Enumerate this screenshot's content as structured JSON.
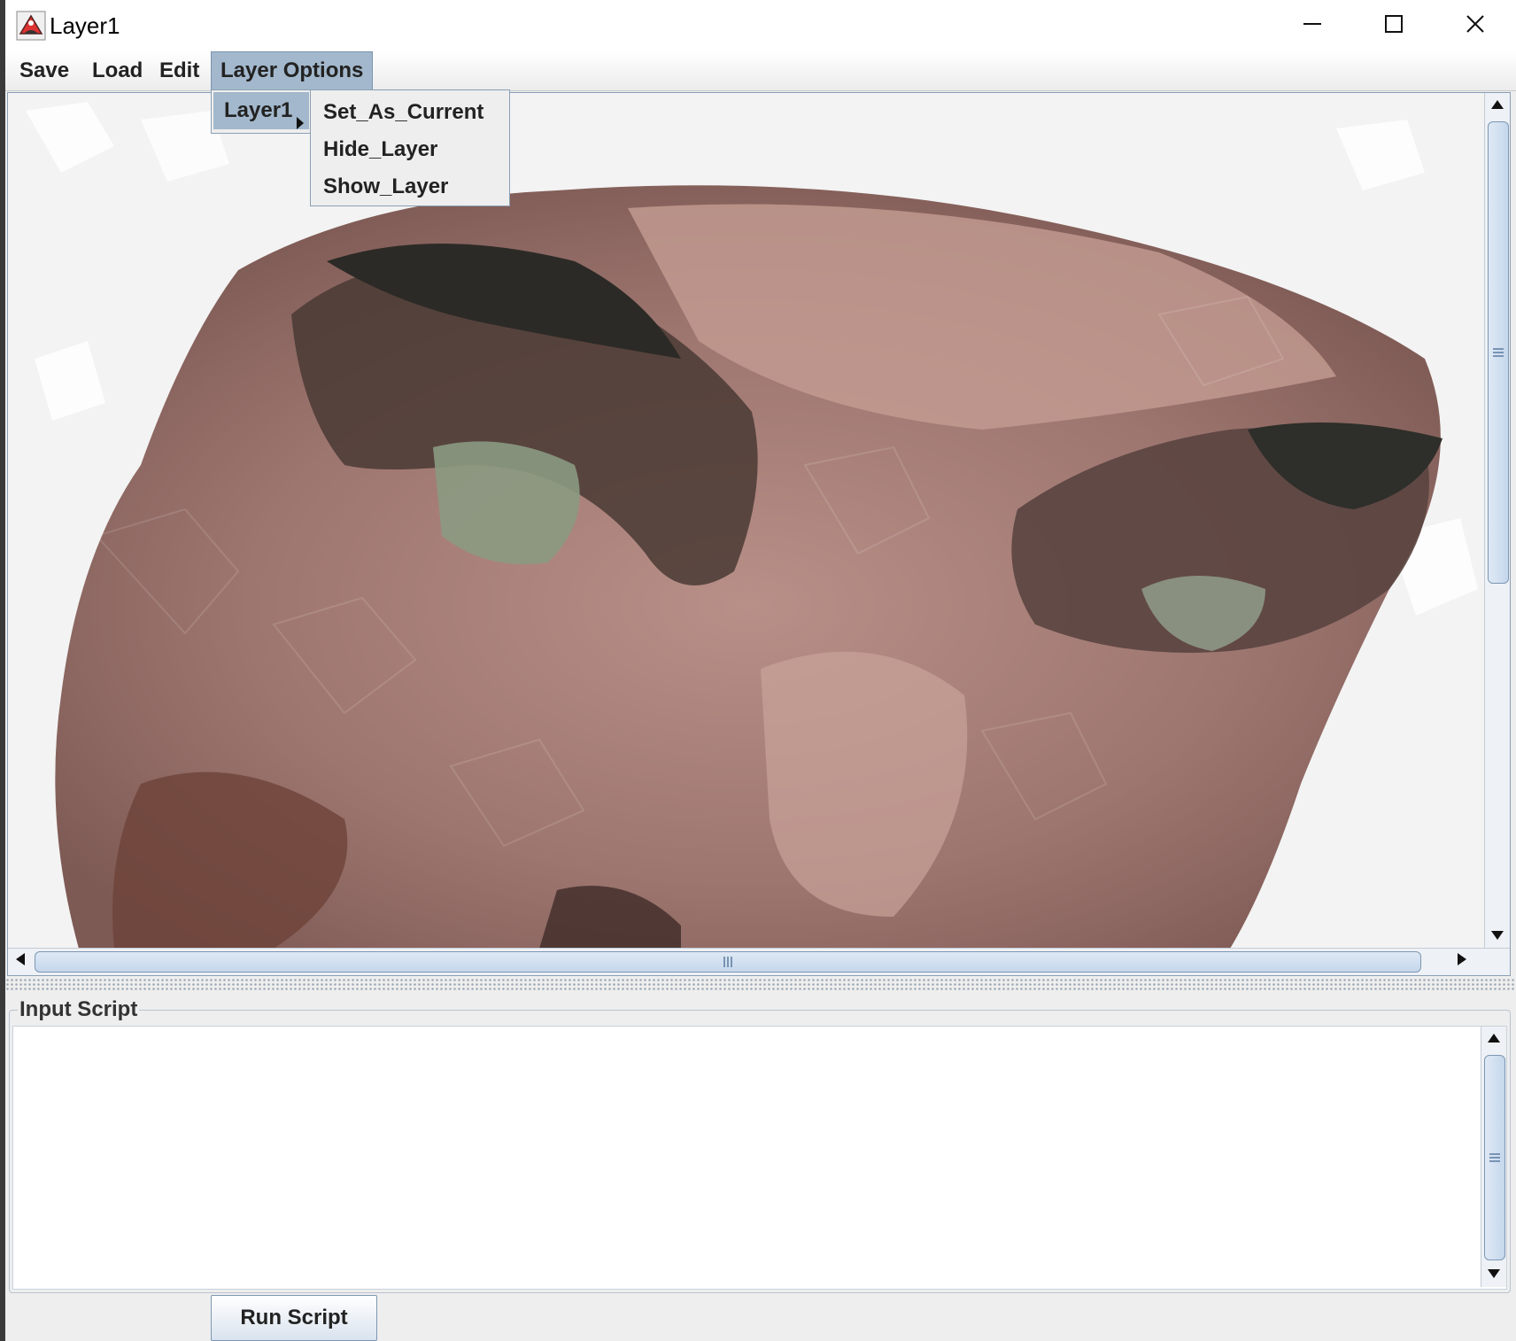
{
  "window": {
    "title": "Layer1",
    "icon": "java-app-icon",
    "controls": [
      "minimize-icon",
      "maximize-icon",
      "close-icon"
    ]
  },
  "menubar": {
    "items": [
      {
        "label": "Save"
      },
      {
        "label": "Load"
      },
      {
        "label": "Edit"
      },
      {
        "label": "Layer Options",
        "open": true
      }
    ]
  },
  "layer_menu": {
    "items": [
      {
        "label": "Layer1",
        "has_submenu": true,
        "armed": true
      }
    ]
  },
  "layer_submenu": {
    "items": [
      {
        "label": "Set_As_Current"
      },
      {
        "label": "Hide_Layer"
      },
      {
        "label": "Show_Layer"
      }
    ]
  },
  "canvas": {
    "content": "voronoi-mosaic-image",
    "vscroll_position": 0.3,
    "hscroll_position": 0.0
  },
  "script_panel": {
    "title": "Input Script",
    "value": "",
    "vscroll_position": 0.5
  },
  "run_button": {
    "label": "Run Script"
  },
  "colors": {
    "menu_highlight": "#a3b8cc",
    "border": "#7d97b3",
    "scroll_thumb": "#c5d7ec"
  }
}
